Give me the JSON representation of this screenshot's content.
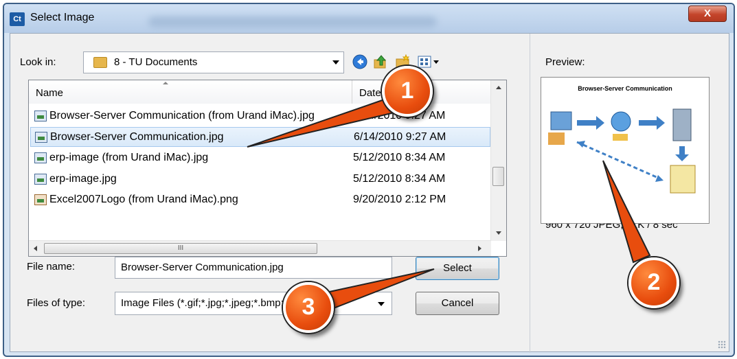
{
  "window": {
    "app_icon_text": "Ct",
    "title": "Select Image",
    "close_label": "X"
  },
  "look_in": {
    "label": "Look in:",
    "value": "8 - TU Documents"
  },
  "file_list": {
    "columns": [
      "Name",
      "Date"
    ],
    "rows": [
      {
        "name": "Browser-Server Communication (from Urand iMac).jpg",
        "date": "6/14/2010 9:27 AM",
        "selected": false
      },
      {
        "name": "Browser-Server Communication.jpg",
        "date": "6/14/2010 9:27 AM",
        "selected": true
      },
      {
        "name": "erp-image (from Urand iMac).jpg",
        "date": "5/12/2010 8:34 AM",
        "selected": false
      },
      {
        "name": "erp-image.jpg",
        "date": "5/12/2010 8:34 AM",
        "selected": false
      },
      {
        "name": "Excel2007Logo (from Urand iMac).png",
        "date": "9/20/2010 2:12 PM",
        "selected": false
      }
    ],
    "hscroll_thumb_grip": "III"
  },
  "file_name": {
    "label": "File name:",
    "value": "Browser-Server Communication.jpg"
  },
  "files_of_type": {
    "label": "Files of type:",
    "value": "Image Files (*.gif;*.jpg;*.jpeg;*.bmp;*.png)"
  },
  "buttons": {
    "select": "Select",
    "cancel": "Cancel"
  },
  "preview": {
    "label": "Preview:",
    "thumbnail_title": "Browser-Server Communication",
    "info": "960 x 720 JPEG, 51K / 8 sec"
  },
  "callouts": [
    "1",
    "2",
    "3"
  ],
  "colors": {
    "callout": "#e84d0e",
    "selection": "#d9e9f9",
    "title_bar": "#b7cde8",
    "close_button": "#c4452b"
  }
}
